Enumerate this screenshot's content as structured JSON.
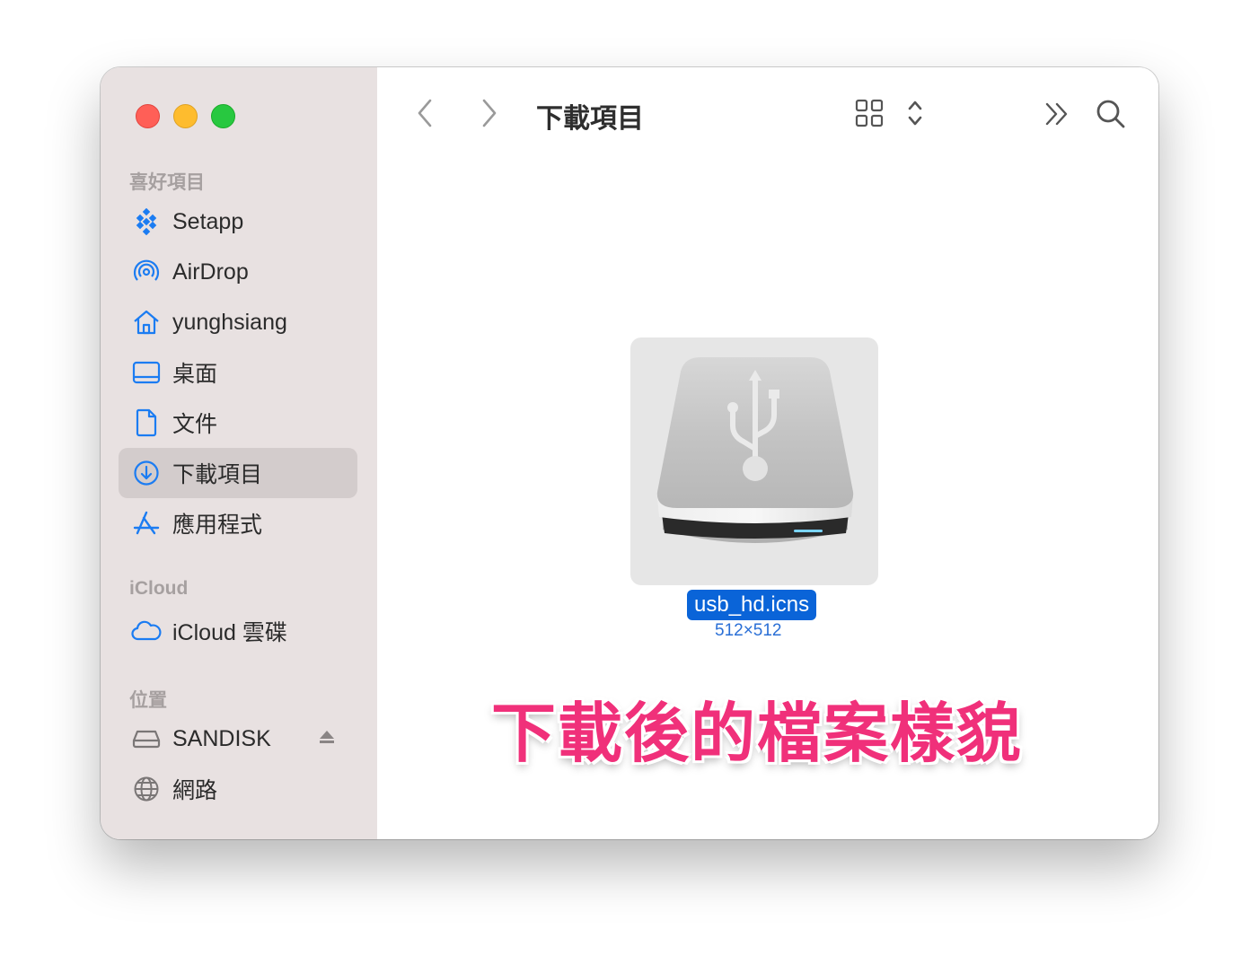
{
  "window": {
    "traffic_lights": {
      "close": "#ff5f57",
      "minimize": "#febc2e",
      "zoom": "#28c840"
    }
  },
  "sidebar": {
    "favorites_title": "喜好項目",
    "favorites": [
      {
        "label": "Setapp",
        "icon": "setapp-icon"
      },
      {
        "label": "AirDrop",
        "icon": "airdrop-icon"
      },
      {
        "label": "yunghsiang",
        "icon": "home-icon"
      },
      {
        "label": "桌面",
        "icon": "desktop-icon"
      },
      {
        "label": "文件",
        "icon": "document-icon"
      },
      {
        "label": "下載項目",
        "icon": "download-icon",
        "selected": true
      },
      {
        "label": "應用程式",
        "icon": "applications-icon"
      }
    ],
    "icloud_title": "iCloud",
    "icloud": [
      {
        "label": "iCloud 雲碟",
        "icon": "cloud-icon"
      }
    ],
    "locations_title": "位置",
    "locations": [
      {
        "label": "SANDISK",
        "icon": "drive-icon"
      },
      {
        "label": "網路",
        "icon": "network-icon"
      }
    ]
  },
  "toolbar": {
    "title": "下載項目",
    "icons": [
      "back-chevron-icon",
      "forward-chevron-icon",
      "grid-view-icon",
      "sort-updown-icon",
      "more-chevrons-icon",
      "search-icon"
    ]
  },
  "file": {
    "name": "usb_hd.icns",
    "dimensions": "512×512",
    "icon": "usb-drive-icon"
  },
  "caption": "下載後的檔案樣貌",
  "colors": {
    "accent": "#0a64d8",
    "caption": "#f0307a",
    "sidebar": "#e8e1e1",
    "icon_blue": "#1b7cf2"
  }
}
